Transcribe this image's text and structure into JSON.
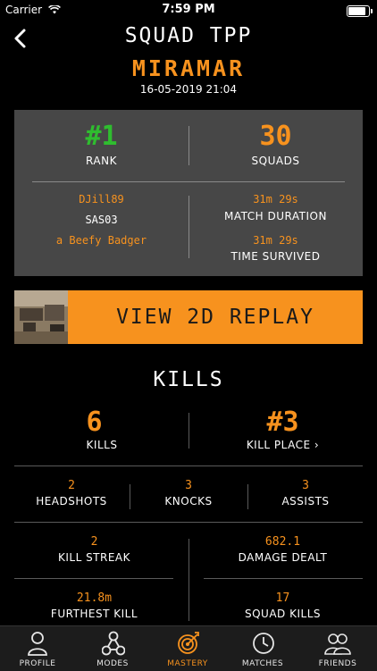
{
  "status_bar": {
    "carrier": "Carrier",
    "time": "7:59 PM",
    "battery_level": 0.95
  },
  "header": {
    "title": "SQUAD TPP",
    "map": "MIRAMAR",
    "date": "16-05-2019 21:04"
  },
  "summary": {
    "rank_value": "#1",
    "rank_label": "RANK",
    "squads_value": "30",
    "squads_label": "SQUADS",
    "players": [
      "DJill89",
      "SAS03",
      "a Beefy Badger"
    ],
    "match_duration_value": "31m 29s",
    "match_duration_label": "MATCH DURATION",
    "time_survived_value": "31m 29s",
    "time_survived_label": "TIME SURVIVED"
  },
  "replay": {
    "label": "VIEW 2D REPLAY"
  },
  "kills": {
    "title": "KILLS",
    "kills_value": "6",
    "kills_label": "KILLS",
    "kill_place_value": "#3",
    "kill_place_label": "KILL PLACE ›",
    "headshots_value": "2",
    "headshots_label": "HEADSHOTS",
    "knocks_value": "3",
    "knocks_label": "KNOCKS",
    "assists_value": "3",
    "assists_label": "ASSISTS",
    "kill_streak_value": "2",
    "kill_streak_label": "KILL STREAK",
    "damage_value": "682.1",
    "damage_label": "DAMAGE DEALT",
    "furthest_value": "21.8m",
    "furthest_label": "FURTHEST KILL",
    "squad_kills_value": "17",
    "squad_kills_label": "SQUAD KILLS"
  },
  "tabs": [
    {
      "label": "PROFILE",
      "icon": "person-icon"
    },
    {
      "label": "MODES",
      "icon": "modes-icon"
    },
    {
      "label": "MASTERY",
      "icon": "target-icon",
      "active": true
    },
    {
      "label": "MATCHES",
      "icon": "clock-icon"
    },
    {
      "label": "FRIENDS",
      "icon": "friends-icon"
    }
  ],
  "colors": {
    "accent": "#f7921e",
    "rank_green": "#2fbd2f",
    "panel": "#474747"
  }
}
